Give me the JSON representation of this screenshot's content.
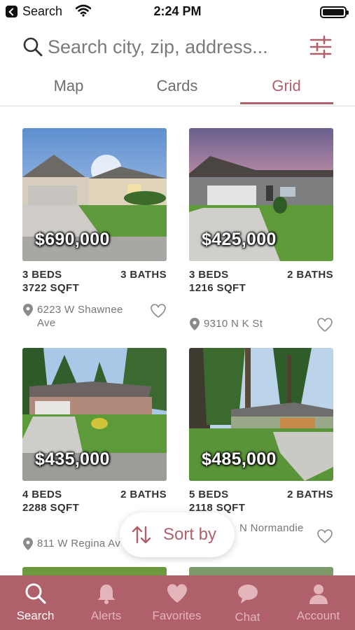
{
  "status_bar": {
    "back_app": "Search",
    "time": "2:24 PM"
  },
  "search": {
    "placeholder": "Search city, zip, address...",
    "value": ""
  },
  "tabs": [
    {
      "label": "Map",
      "active": false
    },
    {
      "label": "Cards",
      "active": false
    },
    {
      "label": "Grid",
      "active": true
    }
  ],
  "listings": [
    {
      "price": "$690,000",
      "beds": "3 BEDS",
      "baths": "3 BATHS",
      "sqft": "3722 SQFT",
      "address": "6223 W Shawnee Ave",
      "favorited": false
    },
    {
      "price": "$425,000",
      "beds": "3 BEDS",
      "baths": "2 BATHS",
      "sqft": "1216 SQFT",
      "address": "9310 N K St",
      "favorited": false
    },
    {
      "price": "$435,000",
      "beds": "4 BEDS",
      "baths": "2 BATHS",
      "sqft": "2288 SQFT",
      "address": "811 W Regina Av",
      "favorited": false
    },
    {
      "price": "$485,000",
      "beds": "5 BEDS",
      "baths": "2 BATHS",
      "sqft": "2118 SQFT",
      "address": "N Normandie",
      "favorited": false
    }
  ],
  "sort": {
    "label": "Sort by"
  },
  "bottom_nav": [
    {
      "label": "Search",
      "icon": "search-icon",
      "active": true
    },
    {
      "label": "Alerts",
      "icon": "bell-icon",
      "active": false
    },
    {
      "label": "Favorites",
      "icon": "heart-icon",
      "active": false
    },
    {
      "label": "Chat",
      "icon": "chat-bubble-icon",
      "active": false
    },
    {
      "label": "Account",
      "icon": "person-icon",
      "active": false
    }
  ],
  "colors": {
    "accent": "#b0606a",
    "nav_background": "#b0606a",
    "nav_inactive_label": "#e3b4ba"
  }
}
